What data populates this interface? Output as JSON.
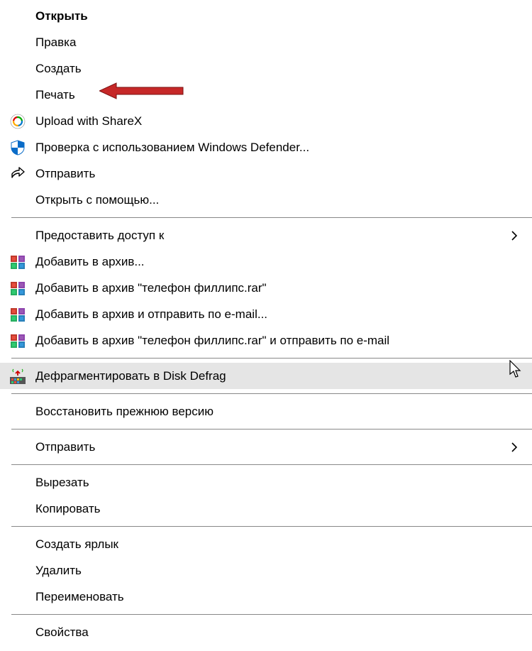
{
  "menu": {
    "items": [
      {
        "label": "Открыть",
        "bold": true
      },
      {
        "label": "Правка"
      },
      {
        "label": "Создать"
      },
      {
        "label": "Печать"
      },
      {
        "label": "Upload with ShareX",
        "icon": "sharex"
      },
      {
        "label": "Проверка с использованием Windows Defender...",
        "icon": "defender"
      },
      {
        "label": "Отправить",
        "icon": "share"
      },
      {
        "label": "Открыть с помощью..."
      },
      {
        "sep": true
      },
      {
        "label": "Предоставить доступ к",
        "sub": true
      },
      {
        "label": "Добавить в архив...",
        "icon": "winrar"
      },
      {
        "label": "Добавить в архив \"телефон филлипс.rar\"",
        "icon": "winrar"
      },
      {
        "label": "Добавить в архив и отправить по e-mail...",
        "icon": "winrar"
      },
      {
        "label": "Добавить в архив \"телефон филлипс.rar\" и отправить по e-mail",
        "icon": "winrar"
      },
      {
        "sep": true
      },
      {
        "label": "Дефрагментировать в Disk Defrag",
        "icon": "defrag",
        "hovered": true
      },
      {
        "sep": true
      },
      {
        "label": "Восстановить прежнюю версию"
      },
      {
        "sep": true
      },
      {
        "label": "Отправить",
        "sub": true
      },
      {
        "sep": true
      },
      {
        "label": "Вырезать"
      },
      {
        "label": "Копировать"
      },
      {
        "sep": true
      },
      {
        "label": "Создать ярлык"
      },
      {
        "label": "Удалить"
      },
      {
        "label": "Переименовать"
      },
      {
        "sep": true
      },
      {
        "label": "Свойства"
      }
    ]
  },
  "annotation": {
    "type": "red-arrow",
    "targets": "Печать"
  }
}
